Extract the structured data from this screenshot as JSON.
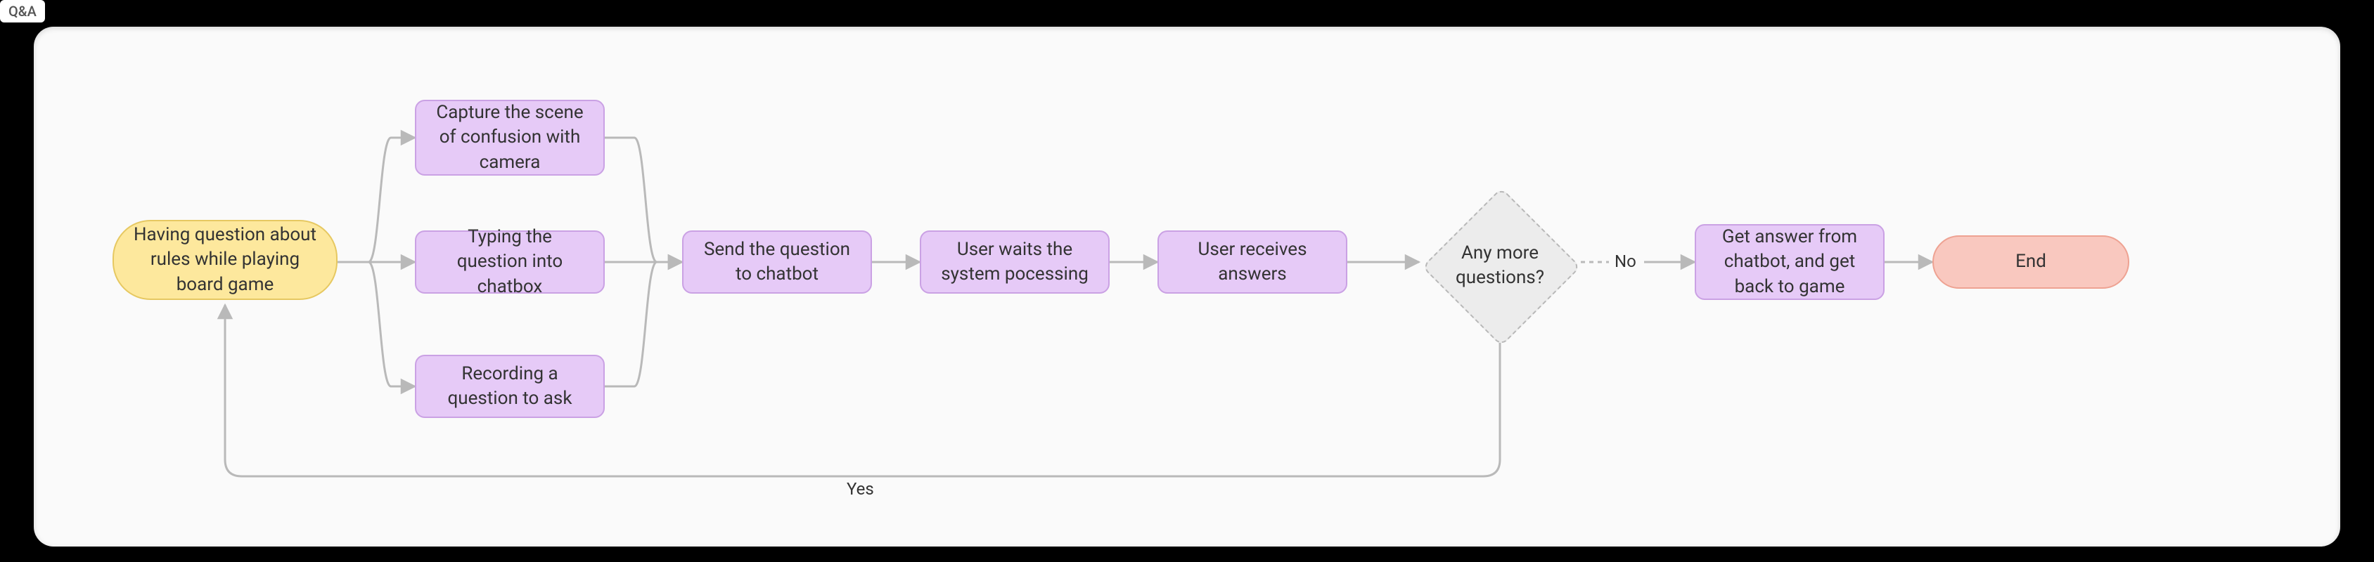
{
  "tab": {
    "label": "Q&A"
  },
  "nodes": {
    "start": {
      "label": "Having question about rules while playing board game"
    },
    "capture": {
      "label": "Capture the scene of confusion with camera"
    },
    "type": {
      "label": "Typing the question into chatbox"
    },
    "record": {
      "label": "Recording a question to ask"
    },
    "send": {
      "label": "Send the question to chatbot"
    },
    "wait": {
      "label": "User waits the system pocessing"
    },
    "recv": {
      "label": "User receives answers"
    },
    "decision": {
      "label": "Any more questions?"
    },
    "getback": {
      "label": "Get answer from chatbot, and get back to game"
    },
    "end": {
      "label": "End"
    }
  },
  "edges": {
    "no": "No",
    "yes": "Yes"
  }
}
